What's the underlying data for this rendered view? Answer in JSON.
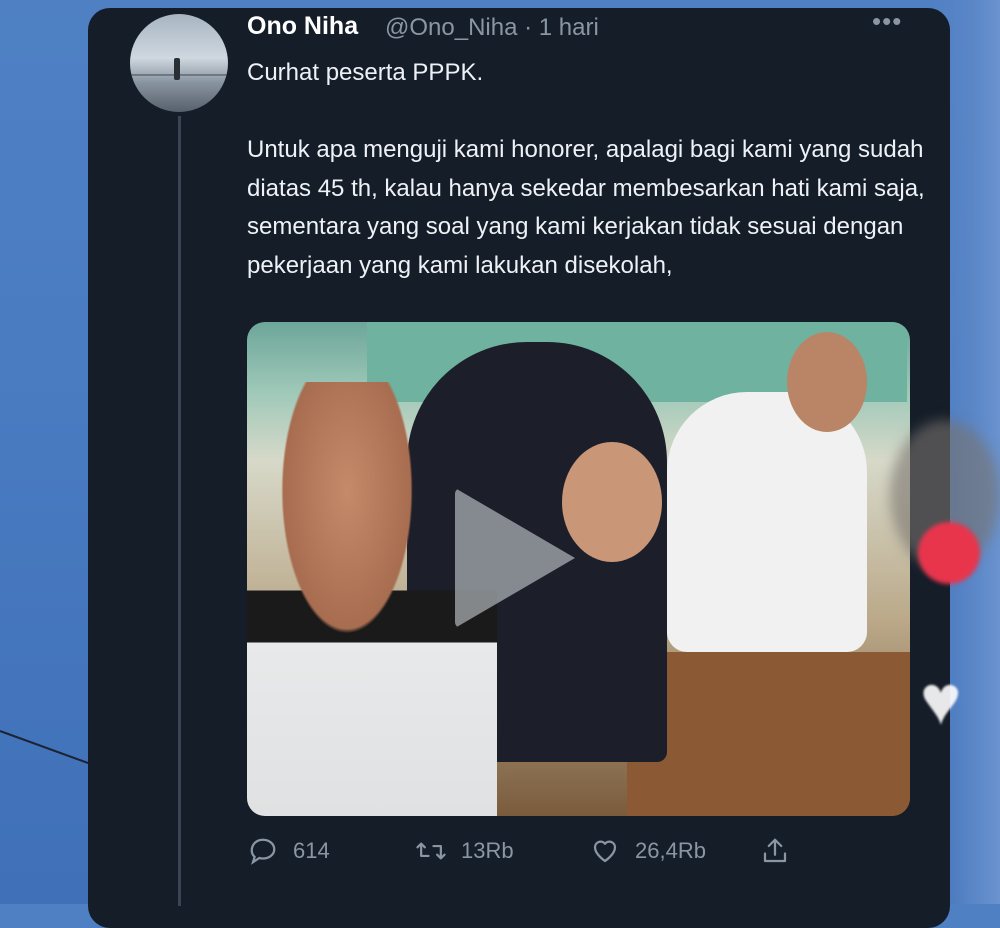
{
  "tweet": {
    "author_name": "Ono Niha",
    "handle_time": "@Ono_Niha · 1 hari",
    "text": "Curhat peserta PPPK.\n\nUntuk apa menguji kami honorer, apalagi bagi kami yang sudah diatas 45 th, kalau hanya sekedar membesarkan hati kami saja, sementara yang soal yang kami kerjakan tidak sesuai dengan pekerjaan yang kami lakukan disekolah,",
    "more_label": "•••"
  },
  "actions": {
    "replies": "614",
    "retweets": "13Rb",
    "likes": "26,4Rb"
  },
  "icons": {
    "reply": "reply-icon",
    "retweet": "retweet-icon",
    "like": "heart-icon",
    "share": "share-icon",
    "play": "play-icon"
  },
  "colors": {
    "card_bg": "#151d28",
    "muted": "#8a96a4",
    "text": "#eef2f6"
  }
}
